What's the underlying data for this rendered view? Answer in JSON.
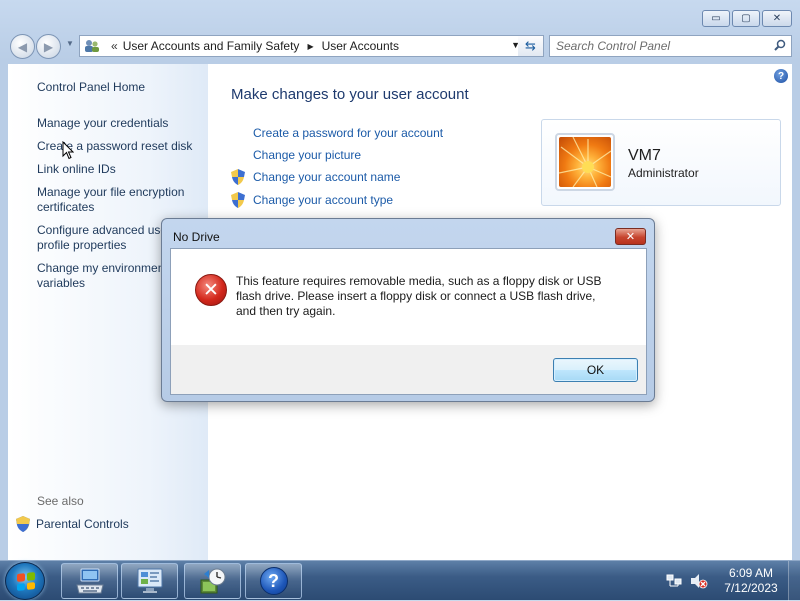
{
  "window": {
    "caption": {
      "minimize": "▭",
      "maximize": "▢",
      "close": "✕"
    }
  },
  "address_bar": {
    "chevron": "«",
    "crumbs": [
      "User Accounts and Family Safety",
      "User Accounts"
    ],
    "search_placeholder": "Search Control Panel"
  },
  "left_pane": {
    "home": "Control Panel Home",
    "links": [
      "Manage your credentials",
      "Create a password reset disk",
      "Link online IDs",
      "Manage your file encryption certificates",
      "Configure advanced user profile properties",
      "Change my environment variables"
    ],
    "see_also_label": "See also",
    "see_also": [
      "Parental Controls"
    ]
  },
  "main": {
    "title": "Make changes to your user account",
    "tasks": [
      {
        "label": "Create a password for your account",
        "shield": false
      },
      {
        "label": "Change your picture",
        "shield": false
      },
      {
        "label": "Change your account name",
        "shield": true
      },
      {
        "label": "Change your account type",
        "shield": true
      }
    ],
    "user": {
      "name": "VM7",
      "role": "Administrator"
    }
  },
  "dialog": {
    "title": "No Drive",
    "message": "This feature requires removable media, such as a floppy disk or USB flash drive. Please insert a floppy disk or connect a USB flash drive, and then try again.",
    "ok_label": "OK",
    "icon": "error-icon"
  },
  "taskbar": {
    "time": "6:09 AM",
    "date": "7/12/2023",
    "pinned": [
      "control-panel-keyboard-icon",
      "user-accounts-icon",
      "backup-restore-icon",
      "help-icon"
    ]
  },
  "colors": {
    "link": "#1c5ba8",
    "nav_link": "#1e395b",
    "title": "#1e3a6e",
    "error_red": "#d3281c"
  }
}
